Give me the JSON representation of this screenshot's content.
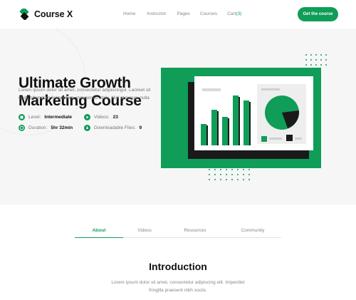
{
  "brand": {
    "name": "Course X",
    "logo_icon": "course-x-logo",
    "accent": "#0f9d58"
  },
  "nav": {
    "items": [
      {
        "label": "Home"
      },
      {
        "label": "Instructor"
      },
      {
        "label": "Pages"
      },
      {
        "label": "Courses"
      }
    ],
    "cart_label": "Cart",
    "cart_count": "(3)"
  },
  "header": {
    "cta_label": "Get the course"
  },
  "hero": {
    "title_line1": "Ultimate Growth",
    "title_line2": "Marketing Course",
    "description": "Lorem ipsum dolor sit amet, consectetur adipiscingol. Laoreet sit enim bibendum fermentum, maecenas atolu. Nisl at purus, nulla",
    "meta": {
      "level_label": "Level:",
      "level_value": "Intermediate",
      "videos_label": "Videos:",
      "videos_value": "23",
      "duration_label": "Duration:",
      "duration_value": "5hr 32min",
      "files_label": "Downloadable Files:",
      "files_value": "9"
    }
  },
  "tabs": [
    {
      "label": "About",
      "active": true
    },
    {
      "label": "Videos",
      "active": false
    },
    {
      "label": "Resources",
      "active": false
    },
    {
      "label": "Community",
      "active": false
    }
  ],
  "intro": {
    "title": "Introduction",
    "text": "Lorem ipsum dolor sit amet, consectetur adipiscing elit. Imperdiet fringilla praesent nibh sociis."
  }
}
